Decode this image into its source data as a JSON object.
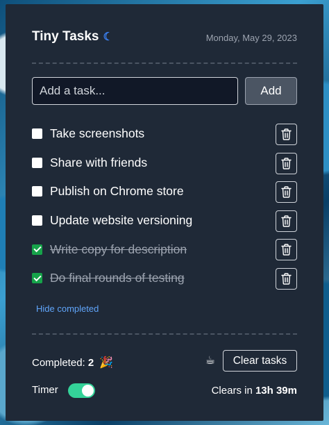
{
  "header": {
    "title": "Tiny Tasks",
    "moon_icon": "moon-icon",
    "date": "Monday, May 29, 2023"
  },
  "add": {
    "placeholder": "Add a task...",
    "value": "",
    "button_label": "Add"
  },
  "tasks": [
    {
      "label": "Take screenshots",
      "done": false
    },
    {
      "label": "Share with friends",
      "done": false
    },
    {
      "label": "Publish on Chrome store",
      "done": false
    },
    {
      "label": "Update website versioning",
      "done": false
    },
    {
      "label": "Write copy for description",
      "done": true
    },
    {
      "label": "Do final rounds of testing",
      "done": true
    }
  ],
  "hide_completed_label": "Hide completed",
  "footer": {
    "completed_label": "Completed:",
    "completed_count": "2",
    "party_emoji": "🎉",
    "coffee_emoji": "☕",
    "clear_button_label": "Clear tasks",
    "timer_label": "Timer",
    "timer_on": true,
    "clears_in_label": "Clears in",
    "clears_in_value": "13h 39m"
  },
  "colors": {
    "panel_bg": "#1f2937",
    "accent_blue": "#60a5fa",
    "toggle_green": "#34d399",
    "checkbox_green": "#16a34a"
  }
}
